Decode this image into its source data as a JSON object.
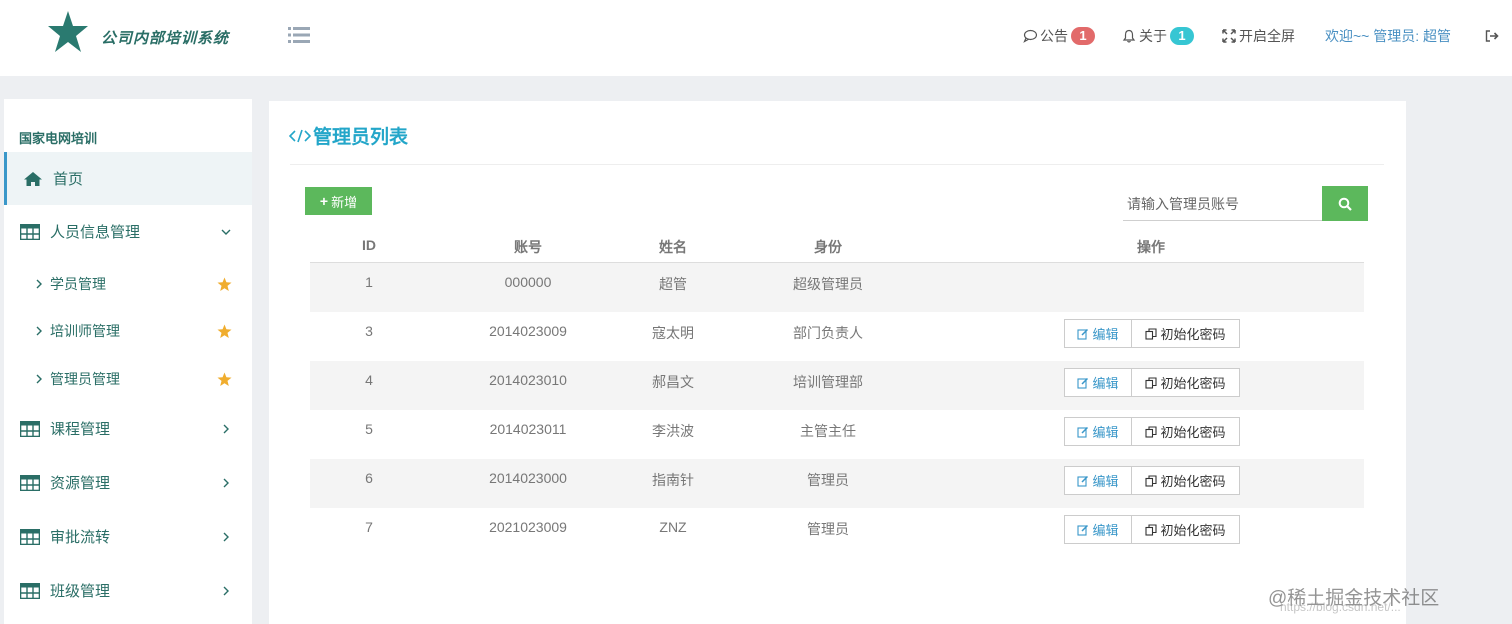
{
  "brand": {
    "logo_text": "公司内部培训系统",
    "star_color": "#2a7a70"
  },
  "topbar": {
    "notice_label": "公告",
    "notice_count": "1",
    "about_label": "关于",
    "about_count": "1",
    "fullscreen_label": "开启全屏",
    "welcome_text": "欢迎~~ 管理员: 超管",
    "colors": {
      "notice_badge": "#e26a6a",
      "about_badge": "#36c6d3"
    }
  },
  "sidebar": {
    "title": "国家电网培训",
    "items": [
      {
        "label": "首页",
        "icon": "home-icon",
        "active": true
      },
      {
        "label": "人员信息管理",
        "icon": "table-icon",
        "expanded": true
      },
      {
        "label": "课程管理",
        "icon": "table-icon"
      },
      {
        "label": "资源管理",
        "icon": "table-icon"
      },
      {
        "label": "审批流转",
        "icon": "table-icon"
      },
      {
        "label": "班级管理",
        "icon": "table-icon"
      }
    ],
    "sub_items": [
      {
        "label": "学员管理",
        "icon": "star-icon"
      },
      {
        "label": "培训师管理",
        "icon": "star-icon"
      },
      {
        "label": "管理员管理",
        "icon": "star-icon"
      }
    ]
  },
  "main": {
    "title": "管理员列表",
    "add_button": "新增",
    "search_placeholder": "请输入管理员账号",
    "columns": [
      "ID",
      "账号",
      "姓名",
      "身份",
      "操作"
    ],
    "rows": [
      {
        "id": "1",
        "account": "000000",
        "name": "超管",
        "role": "超级管理员",
        "ops": false
      },
      {
        "id": "3",
        "account": "2014023009",
        "name": "寇太明",
        "role": "部门负责人",
        "ops": true
      },
      {
        "id": "4",
        "account": "2014023010",
        "name": "郝昌文",
        "role": "培训管理部",
        "ops": true
      },
      {
        "id": "5",
        "account": "2014023011",
        "name": "李洪波",
        "role": "主管主任",
        "ops": true
      },
      {
        "id": "6",
        "account": "2014023000",
        "name": "指南针",
        "role": "管理员",
        "ops": true
      },
      {
        "id": "7",
        "account": "2021023009",
        "name": "ZNZ",
        "role": "管理员",
        "ops": true
      }
    ],
    "edit_label": "编辑",
    "reset_label": "初始化密码"
  },
  "watermark": {
    "text": "@稀土掘金技术社区",
    "url": "https://blog.csdn.net/..."
  }
}
